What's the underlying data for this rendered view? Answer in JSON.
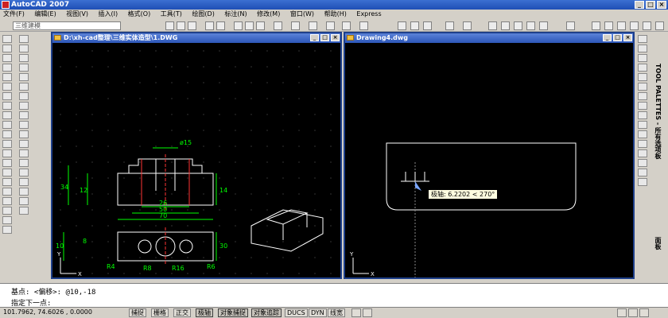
{
  "window": {
    "title": "AutoCAD 2007"
  },
  "menu": [
    "文件(F)",
    "编辑(E)",
    "视图(V)",
    "插入(I)",
    "格式(O)",
    "工具(T)",
    "绘图(D)",
    "标注(N)",
    "修改(M)",
    "窗口(W)",
    "帮助(H)",
    "Express"
  ],
  "toolbar": {
    "layer_box": "三维建模"
  },
  "left_drawing": {
    "title": "D:\\xh-cad整理\\三维实体造型\\1.DWG",
    "dims": [
      "ø15",
      "34",
      "12",
      "14",
      "26",
      "50",
      "70",
      "10",
      "30",
      "R4",
      "R8",
      "R16",
      "R6",
      "8"
    ],
    "axis_x": "X",
    "axis_y": "Y"
  },
  "right_drawing": {
    "title": "Drawing4.dwg",
    "tooltip": "极轴: 6.2202 < 270°",
    "axis_x": "X",
    "axis_y": "Y"
  },
  "right_palette": {
    "label1": "TOOL PALETTES - 所有选项板",
    "label2": "面板"
  },
  "command": {
    "line1": "基点: <偏移>: @10,-18",
    "line2": "指定下一点:"
  },
  "status": {
    "coords": "101.7962, 74.6026 , 0.0000",
    "toggles": [
      "捕捉",
      "栅格",
      "正交",
      "极轴",
      "对象捕捉",
      "对象追踪",
      "DUCS",
      "DYN",
      "线宽"
    ]
  }
}
